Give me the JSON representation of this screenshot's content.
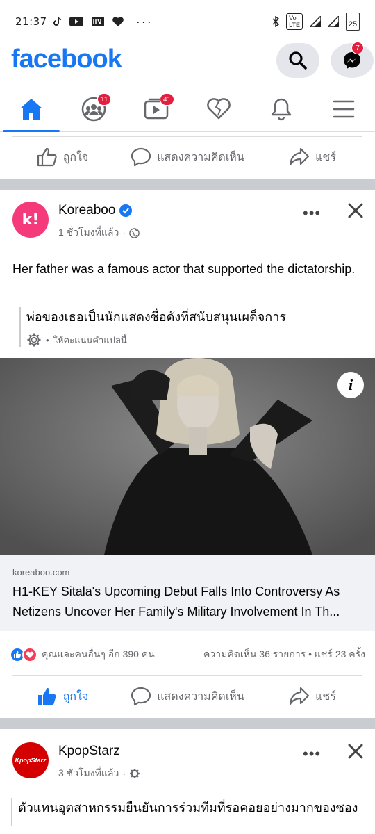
{
  "status_bar": {
    "time": "21:37",
    "battery": "25",
    "network": "4G"
  },
  "header": {
    "logo": "facebook",
    "messenger_badge": "7"
  },
  "tabs": [
    {
      "name": "home",
      "badge": ""
    },
    {
      "name": "groups",
      "badge": "11"
    },
    {
      "name": "watch",
      "badge": "41"
    },
    {
      "name": "dating",
      "badge": ""
    },
    {
      "name": "notifications",
      "badge": ""
    },
    {
      "name": "menu",
      "badge": ""
    }
  ],
  "actions": {
    "like": "ถูกใจ",
    "comment": "แสดงความคิดเห็น",
    "share": "แชร์"
  },
  "post1": {
    "page_name": "Koreaboo",
    "avatar_letter": "k!",
    "time": "1 ชั่วโมงที่แล้ว",
    "text": "Her father was a famous actor that supported the dictatorship.",
    "translation": "พ่อของเธอเป็นนักแสดงชื่อดังที่สนับสนุนเผด็จการ",
    "rate_translation": "ให้คะแนนคำแปลนี้",
    "link_domain": "koreaboo.com",
    "link_title_1": "H1-KEY Sitala's Upcoming Debut Falls Into Controversy As",
    "link_title_2": "Netizens Uncover Her Family's Military Involvement In Th...",
    "reactions_text": "คุณและคนอื่นๆ อีก 390 คน",
    "comments_shares": "ความคิดเห็น 36 รายการ • แชร์ 23 ครั้ง"
  },
  "post2": {
    "page_name": "KpopStarz",
    "avatar_text": "KpopStarz",
    "time": "3 ชั่วโมงที่แล้ว",
    "text": "ตัวแทนอุตสาหกรรมยืนยันการร่วมทีมที่รอคอยอย่างมากของซอง"
  },
  "colors": {
    "brand": "#1877f2",
    "badge": "#e41e3f",
    "koreaboo": "#f43a7a",
    "kpopstarz": "#d40000"
  }
}
